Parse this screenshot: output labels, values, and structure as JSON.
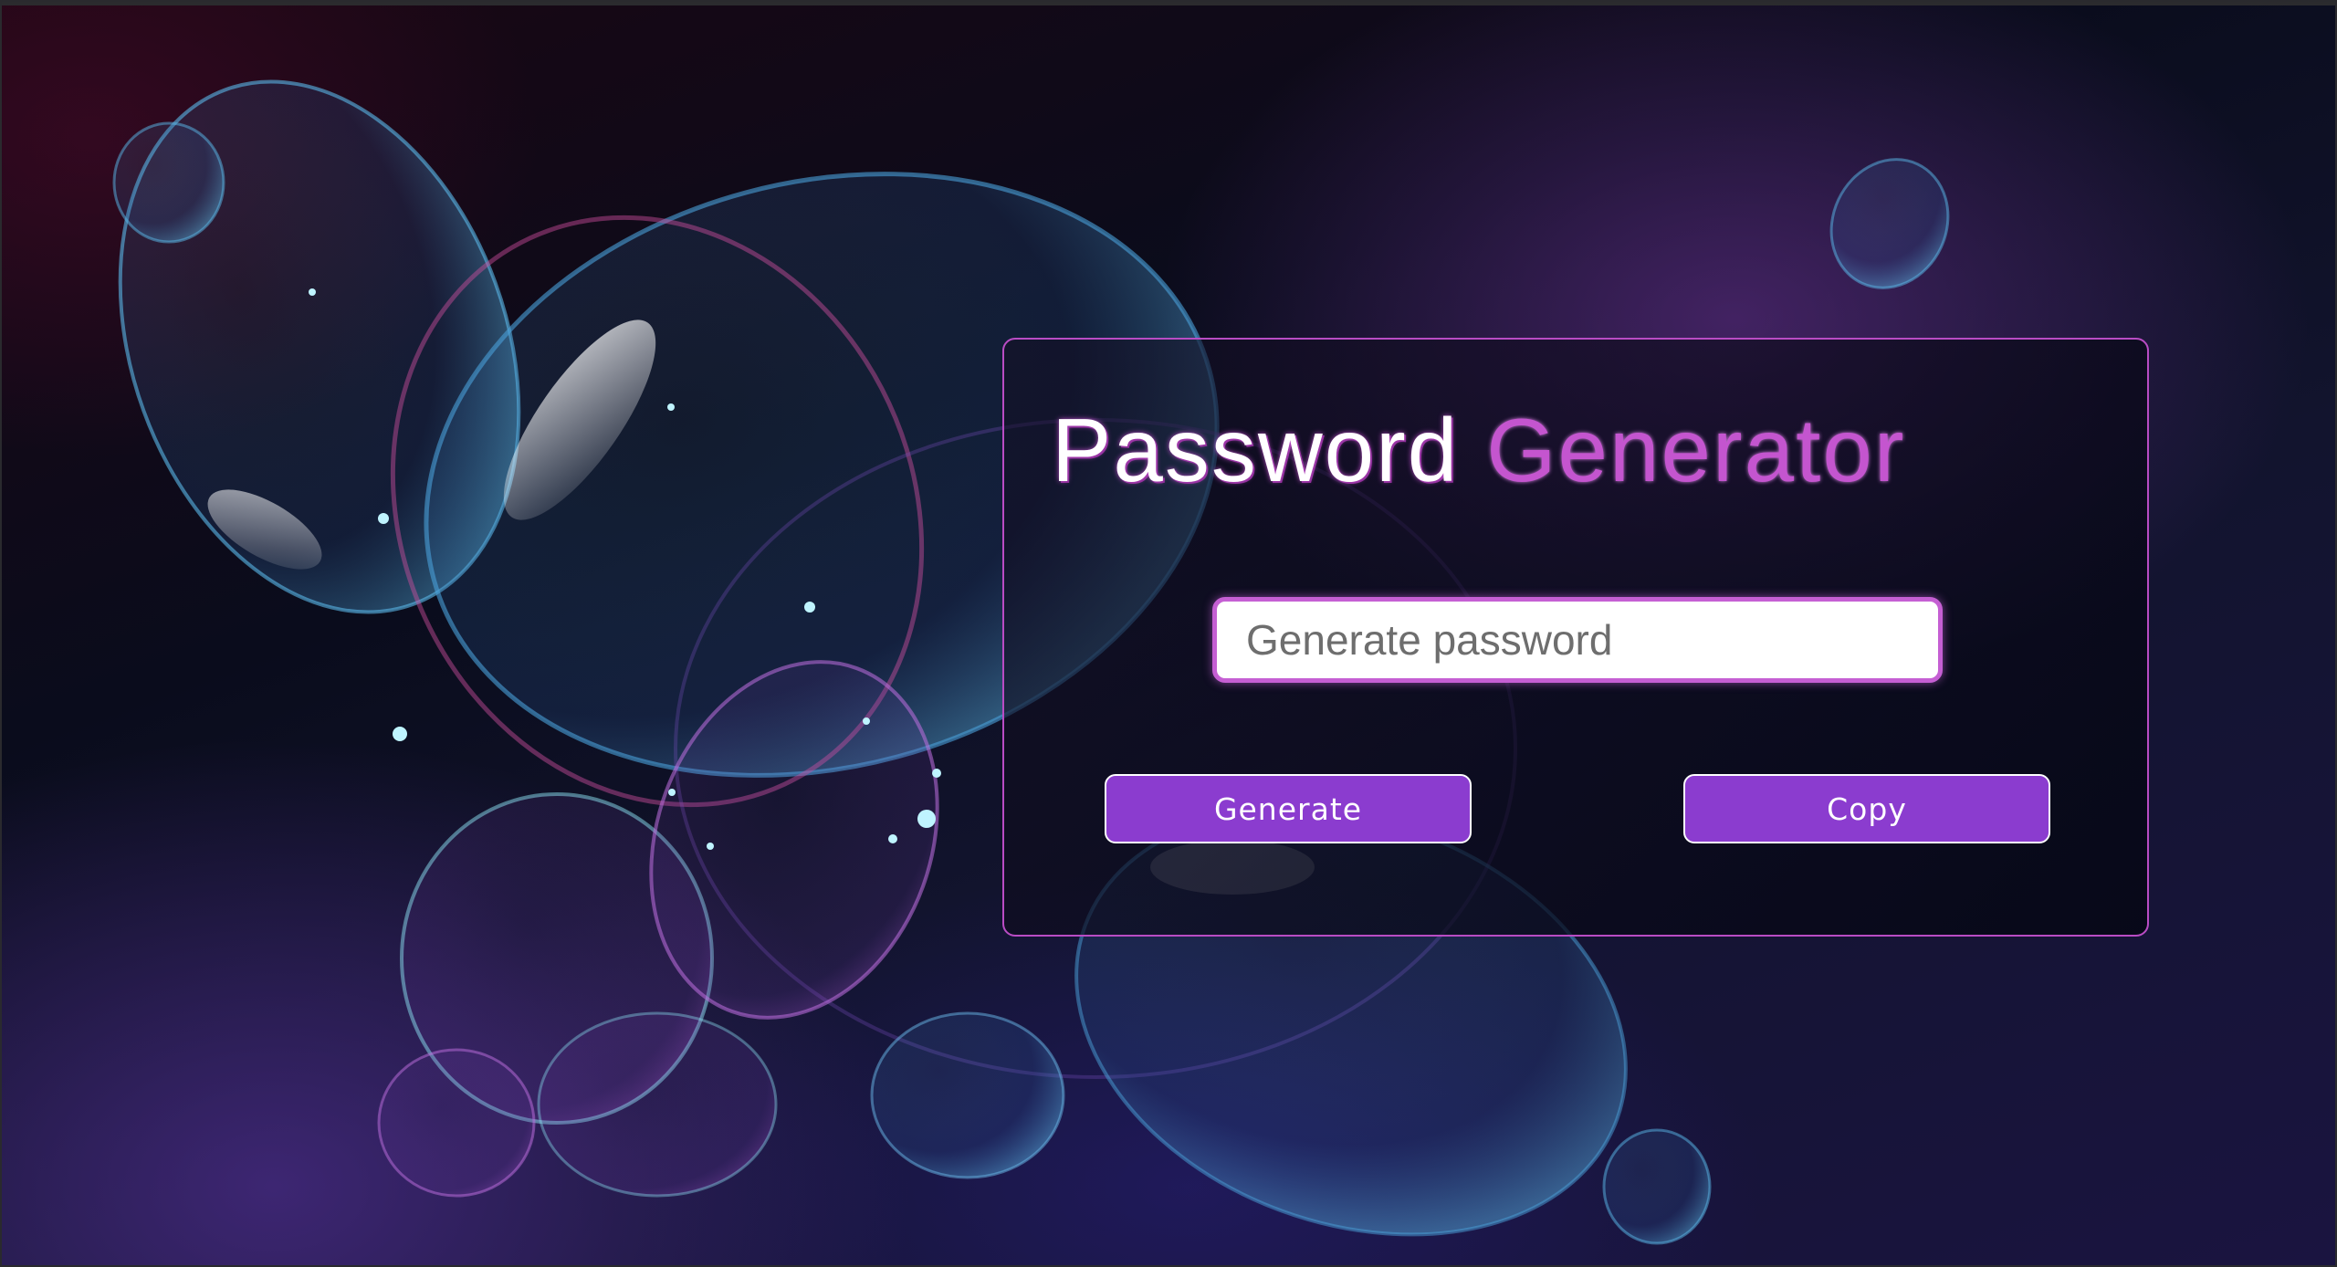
{
  "header": {
    "title_part1": "Password",
    "title_part2": "Generator"
  },
  "password_field": {
    "placeholder": "Generate password",
    "value": ""
  },
  "buttons": {
    "generate_label": "Generate",
    "copy_label": "Copy"
  },
  "colors": {
    "accent": "#8b3ccf",
    "title_highlight": "#c455cf",
    "card_border": "#b94cc4"
  }
}
